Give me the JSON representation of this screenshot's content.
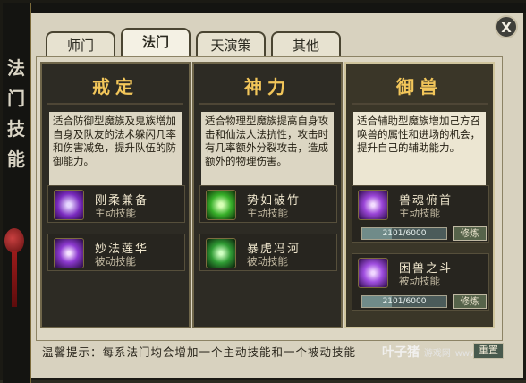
{
  "window": {
    "side_title": [
      "法",
      "门",
      "技",
      "能"
    ],
    "close_label": "X"
  },
  "tabs": [
    {
      "label": "师门",
      "active": false
    },
    {
      "label": "法门",
      "active": true
    },
    {
      "label": "天演策",
      "active": false
    },
    {
      "label": "其他",
      "active": false
    }
  ],
  "schools": [
    {
      "title": "戒定",
      "description": "适合防御型魔族及鬼族增加自身及队友的法术躲闪几率和伤害减免，提升队伍的防御能力。",
      "skills": [
        {
          "name": "刚柔兼备",
          "type": "主动技能",
          "icon": "yin-yang-icon"
        },
        {
          "name": "妙法莲华",
          "type": "被动技能",
          "icon": "lotus-icon"
        }
      ]
    },
    {
      "title": "神力",
      "description": "适合物理型魔族提高自身攻击和仙法人法抗性，攻击时有几率额外分裂攻击，造成额外的物理伤害。",
      "skills": [
        {
          "name": "势如破竹",
          "type": "主动技能",
          "icon": "green-bamboo-icon"
        },
        {
          "name": "暴虎冯河",
          "type": "被动技能",
          "icon": "tiger-icon"
        }
      ]
    },
    {
      "title": "御兽",
      "description": "适合辅助型魔族增加己方召唤兽的属性和进场的机会，提升自己的辅助能力。",
      "skills": [
        {
          "name": "兽魂俯首",
          "type": "主动技能",
          "icon": "beast-soul-icon",
          "progress_text": "2101/6000",
          "progress": 0.35,
          "button": "修炼"
        },
        {
          "name": "困兽之斗",
          "type": "被动技能",
          "icon": "beast-fight-icon",
          "progress_text": "2101/6000",
          "progress": 0.35,
          "button": "修炼"
        }
      ]
    }
  ],
  "footer": {
    "hint": "温馨提示：每系法门均会增加一个主动技能和一个被动技能",
    "reset_label": "重置",
    "watermark_brand": "叶子猪",
    "watermark_sub": "游戏网",
    "watermark_url": "www.yzz"
  }
}
